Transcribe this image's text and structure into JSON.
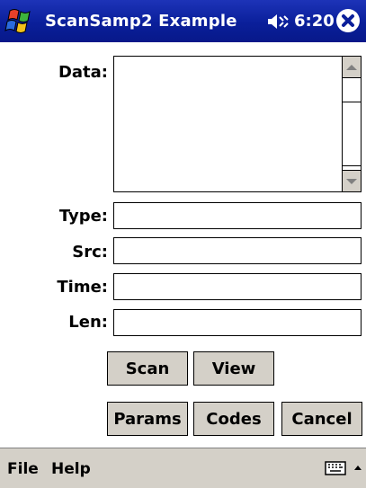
{
  "titlebar": {
    "title": "ScanSamp2 Example",
    "time": "6:20",
    "start_icon": "windows-flag-icon",
    "volume_icon": "speaker-icon",
    "close_icon": "close-icon"
  },
  "form": {
    "data_label": "Data:",
    "type_label": "Type:",
    "src_label": "Src:",
    "time_label": "Time:",
    "len_label": "Len:",
    "data_value": "",
    "type_value": "",
    "src_value": "",
    "time_value": "",
    "len_value": ""
  },
  "buttons": {
    "scan": "Scan",
    "view": "View",
    "params": "Params",
    "codes": "Codes",
    "cancel": "Cancel"
  },
  "menubar": {
    "file": "File",
    "help": "Help",
    "keyboard_icon": "keyboard-icon",
    "sip_icon": "up-arrow-icon"
  },
  "colors": {
    "titlebar": "#0a1f9a",
    "button_face": "#d4d0c8",
    "menubar": "#d4d0c8"
  }
}
